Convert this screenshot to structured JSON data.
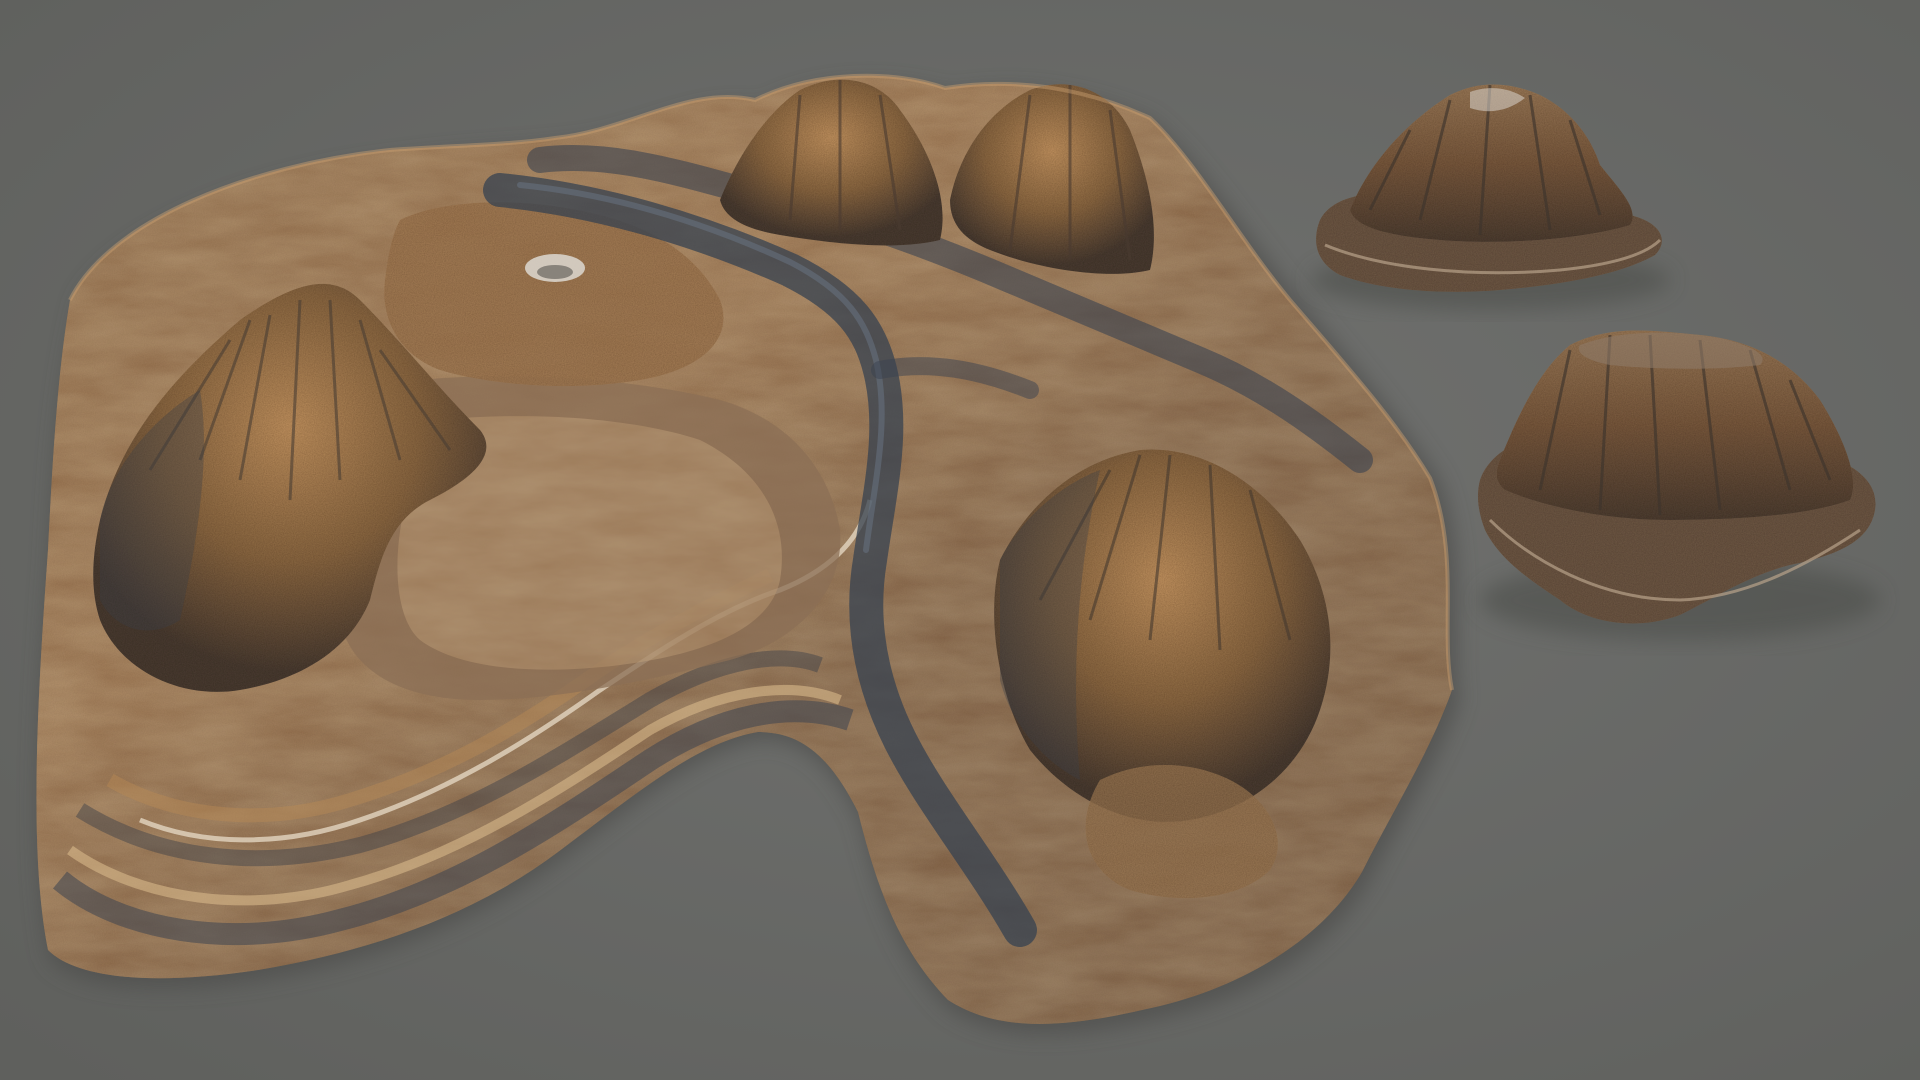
{
  "scene": {
    "background_color": "#6b6c69",
    "background_shade_color": "#5f605d",
    "rock_base_color": "#7a5a3a",
    "rock_highlight_color": "#c8945a",
    "rock_shadow_color": "#3a3f48",
    "rock_mid_color": "#8e6a45",
    "strata_light_color": "#d9c8b0",
    "objects": [
      {
        "name": "large-terrain-landmass"
      },
      {
        "name": "small-rock-formation-top"
      },
      {
        "name": "small-rock-formation-bottom"
      }
    ]
  }
}
